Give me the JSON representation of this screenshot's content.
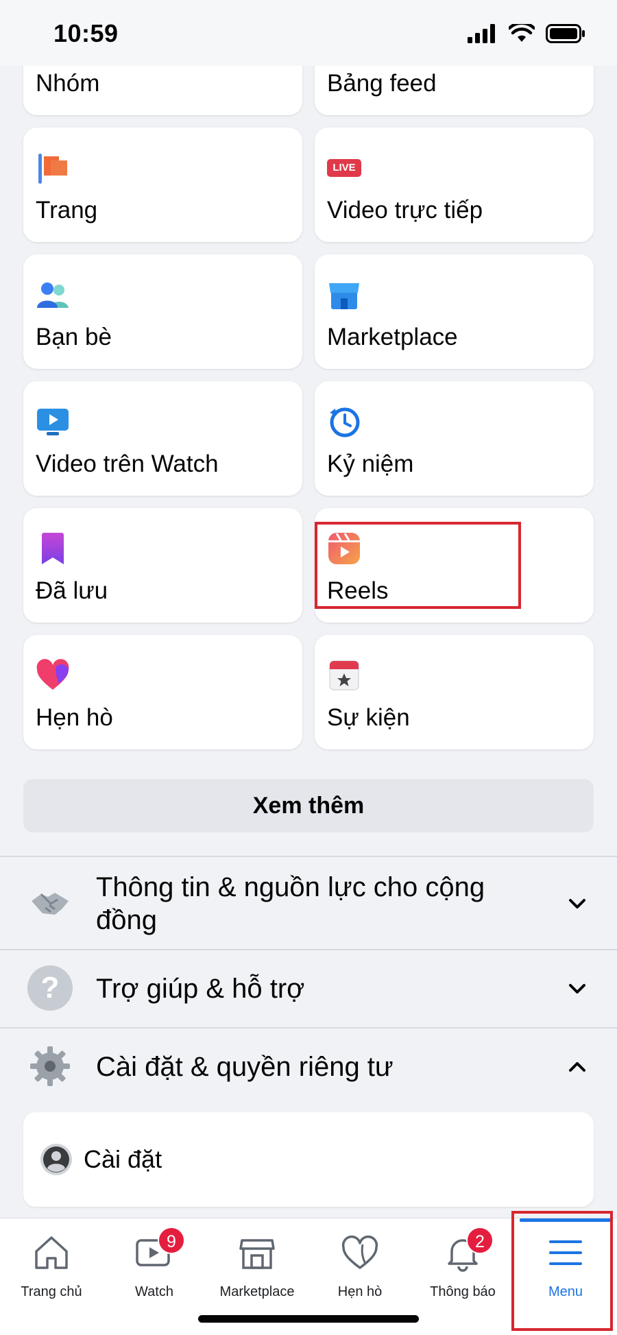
{
  "status_bar": {
    "time": "10:59"
  },
  "shortcuts": [
    {
      "label": "Nhóm",
      "icon": "group-icon"
    },
    {
      "label": "Bảng feed",
      "icon": "feed-icon"
    },
    {
      "label": "Trang",
      "icon": "flag-icon"
    },
    {
      "label": "Video trực tiếp",
      "icon": "live-icon",
      "badge_text": "LIVE"
    },
    {
      "label": "Bạn bè",
      "icon": "friends-icon"
    },
    {
      "label": "Marketplace",
      "icon": "shop-icon"
    },
    {
      "label": "Video trên Watch",
      "icon": "watch-icon"
    },
    {
      "label": "Kỷ niệm",
      "icon": "memories-icon"
    },
    {
      "label": "Đã lưu",
      "icon": "bookmark-icon"
    },
    {
      "label": "Reels",
      "icon": "reels-icon"
    },
    {
      "label": "Hẹn hò",
      "icon": "heart-icon"
    },
    {
      "label": "Sự kiện",
      "icon": "calendar-icon"
    }
  ],
  "see_more": "Xem thêm",
  "sections": [
    {
      "label_line1": "Thông tin & nguồn lực cho cộng",
      "label_line2": "đồng",
      "icon": "handshake-icon",
      "expanded": false
    },
    {
      "label": "Trợ giúp & hỗ trợ",
      "icon": "question-icon",
      "expanded": false
    },
    {
      "label": "Cài đặt & quyền riêng tư",
      "icon": "gear-icon",
      "expanded": true
    }
  ],
  "settings_item": {
    "label": "Cài đặt",
    "icon": "profile-icon"
  },
  "tabbar": {
    "tabs": [
      {
        "label": "Trang chủ",
        "icon": "home-icon"
      },
      {
        "label": "Watch",
        "icon": "video-icon",
        "badge": "9"
      },
      {
        "label": "Marketplace",
        "icon": "store-icon"
      },
      {
        "label": "Hẹn hò",
        "icon": "heart-outline-icon"
      },
      {
        "label": "Thông báo",
        "icon": "bell-icon",
        "badge": "2"
      },
      {
        "label": "Menu",
        "icon": "menu-icon",
        "active": true
      }
    ]
  },
  "colors": {
    "accent": "#1b74e4",
    "badge": "#e41e3f",
    "highlight_box": "#d7262f"
  }
}
